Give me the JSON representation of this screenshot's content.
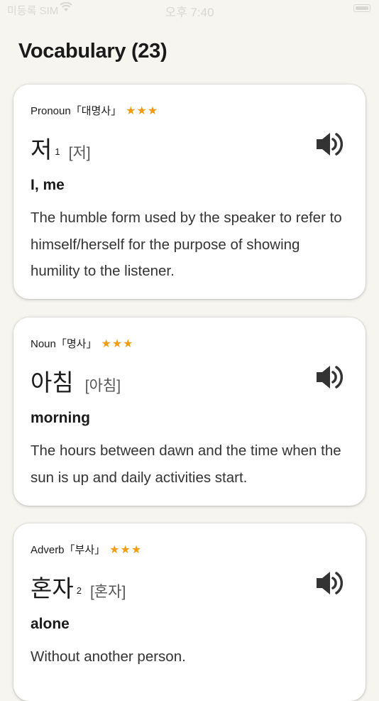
{
  "status_bar": {
    "carrier": "미등록 SIM",
    "time": "오후 7:40"
  },
  "page": {
    "title": "Vocabulary (23)"
  },
  "colors": {
    "star": "#f39c12",
    "background": "#f7f5f0"
  },
  "entries": [
    {
      "pos": "Pronoun「대명사」",
      "stars": "★★★",
      "word": "저",
      "homonym": "1",
      "pronunciation": "[저]",
      "gloss": "I, me",
      "definition": "The humble form used by the speaker to refer to himself/herself for the purpose of showing humility to the listener.",
      "icon": "speaker-icon"
    },
    {
      "pos": "Noun「명사」",
      "stars": "★★★",
      "word": "아침",
      "homonym": "",
      "pronunciation": "[아침]",
      "gloss": "morning",
      "definition": "The hours between dawn and the time when the sun is up and daily activities start.",
      "icon": "speaker-icon"
    },
    {
      "pos": "Adverb「부사」",
      "stars": "★★★",
      "word": "혼자",
      "homonym": "2",
      "pronunciation": "[혼자]",
      "gloss": "alone",
      "definition": "Without another person.",
      "icon": "speaker-icon"
    }
  ]
}
